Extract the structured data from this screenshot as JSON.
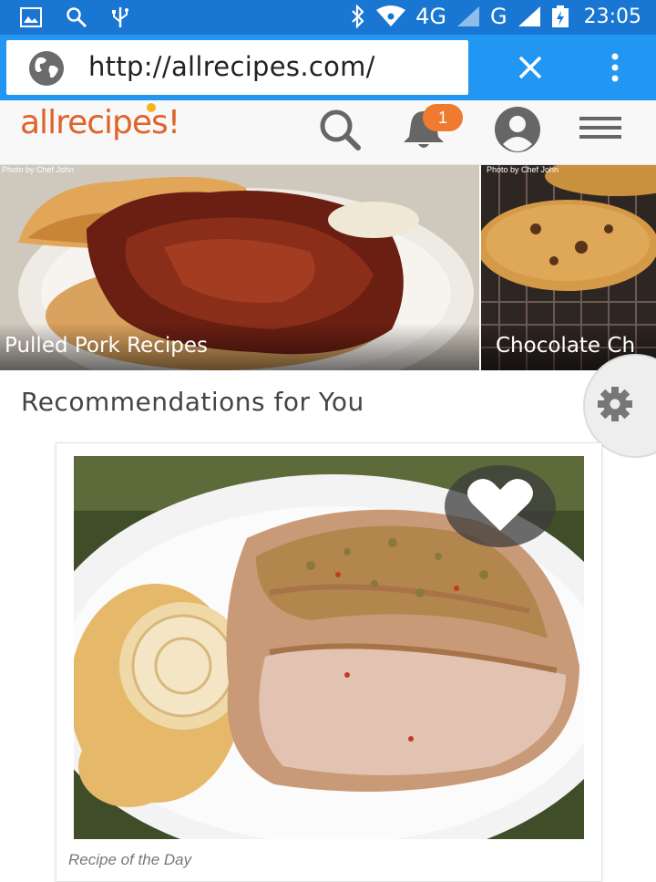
{
  "status_bar": {
    "network": "4G",
    "network2": "G",
    "time": "23:05",
    "icons": [
      "image-icon",
      "search-icon",
      "usb-icon",
      "bluetooth-icon",
      "wifi-icon",
      "signal-icon",
      "battery-icon"
    ]
  },
  "browser": {
    "url": "http://allrecipes.com/",
    "icons": [
      "globe-icon",
      "close-icon",
      "more-vert-icon"
    ]
  },
  "site_header": {
    "logo": "allrecipes",
    "notification_count": "1",
    "icons": [
      "search-icon",
      "bell-icon",
      "profile-icon",
      "hamburger-menu-icon"
    ],
    "accent_color": "#e0632b",
    "badge_color": "#f07a30"
  },
  "carousel": {
    "slides": [
      {
        "label": "Pulled Pork Recipes",
        "credit": "Photo by Chef John"
      },
      {
        "label": "Chocolate Ch",
        "credit": "Photo by Chef John"
      }
    ]
  },
  "recommendations": {
    "title": "Recommendations for You",
    "card": {
      "caption": "Recipe of the Day"
    }
  }
}
